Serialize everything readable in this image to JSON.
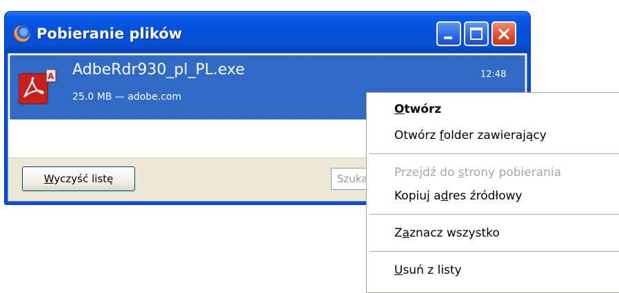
{
  "window": {
    "title": "Pobieranie plików",
    "buttons": {
      "minimize": "minimize-icon",
      "maximize": "maximize-icon",
      "close": "×"
    }
  },
  "download": {
    "icon": "adobe-reader-icon",
    "file_name": "AdbeRdr930_pl_PL.exe",
    "meta": "25.0 MB — adobe.com",
    "time": "12:48"
  },
  "footer": {
    "clear_button": {
      "pre": "",
      "accel": "W",
      "post": "yczyść listę"
    },
    "search_placeholder": "Szukaj..."
  },
  "context_menu": {
    "items": [
      {
        "pre": "",
        "accel": "O",
        "post": "twórz",
        "bold": true,
        "disabled": false
      },
      {
        "pre": "Otwórz ",
        "accel": "f",
        "post": "older zawierający",
        "bold": false,
        "disabled": false
      },
      {
        "pre": "Przejdź do ",
        "accel": "s",
        "post": "trony pobierania",
        "bold": false,
        "disabled": true
      },
      {
        "pre": "Kopiuj a",
        "accel": "d",
        "post": "res źródłowy",
        "bold": false,
        "disabled": false
      },
      {
        "pre": "Z",
        "accel": "a",
        "post": "znacz wszystko",
        "bold": false,
        "disabled": false
      },
      {
        "pre": "",
        "accel": "U",
        "post": "suń z listy",
        "bold": false,
        "disabled": false
      }
    ]
  },
  "colors": {
    "titlebar": "#0550dc",
    "selection": "#316ac5",
    "adobe_red": "#c8201c"
  }
}
